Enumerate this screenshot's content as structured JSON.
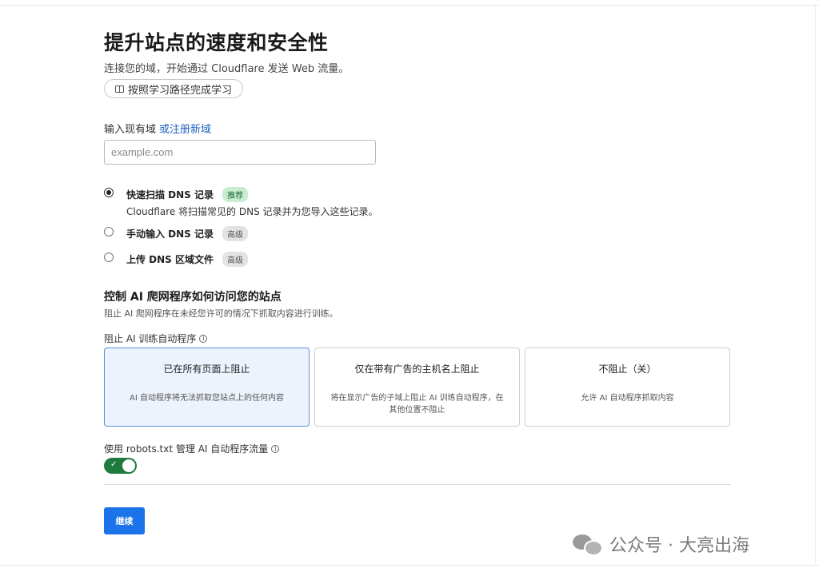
{
  "header": {
    "title": "提升站点的速度和安全性",
    "subtitle": "连接您的域，开始通过 Cloudflare 发送 Web 流量。",
    "learning_path_button": "按照学习路径完成学习"
  },
  "domain": {
    "label": "输入现有域",
    "register_link": "或注册新域",
    "placeholder": "example.com",
    "value": ""
  },
  "dns_options": [
    {
      "label": "快速扫描 DNS 记录",
      "badge": "推荐",
      "description": "Cloudflare 将扫描常见的 DNS 记录并为您导入这些记录。",
      "selected": true
    },
    {
      "label": "手动输入 DNS 记录",
      "badge": "高级",
      "selected": false
    },
    {
      "label": "上传 DNS 区域文件",
      "badge": "高级",
      "selected": false
    }
  ],
  "ai_section": {
    "heading": "控制 AI 爬网程序如何访问您的站点",
    "description": "阻止 AI 爬网程序在未经您许可的情况下抓取内容进行训练。",
    "block_label": "阻止 AI 训练自动程序",
    "cards": [
      {
        "title": "已在所有页面上阻止",
        "description": "AI 自动程序将无法抓取您站点上的任何内容",
        "selected": true
      },
      {
        "title": "仅在带有广告的主机名上阻止",
        "description": "将在显示广告的子域上阻止 AI 训练自动程序，在其他位置不阻止",
        "selected": false
      },
      {
        "title": "不阻止（关）",
        "description": "允许 AI 自动程序抓取内容",
        "selected": false
      }
    ],
    "robots_label": "使用 robots.txt 管理 AI 自动程序流量",
    "robots_enabled": true
  },
  "continue_button": "继续",
  "watermark": "公众号 · 大亮出海",
  "colors": {
    "primary_button": "#1a73e8",
    "toggle_on": "#1f7a3d",
    "link": "#1f5fc4",
    "selected_card_bg": "#edf3fc"
  }
}
